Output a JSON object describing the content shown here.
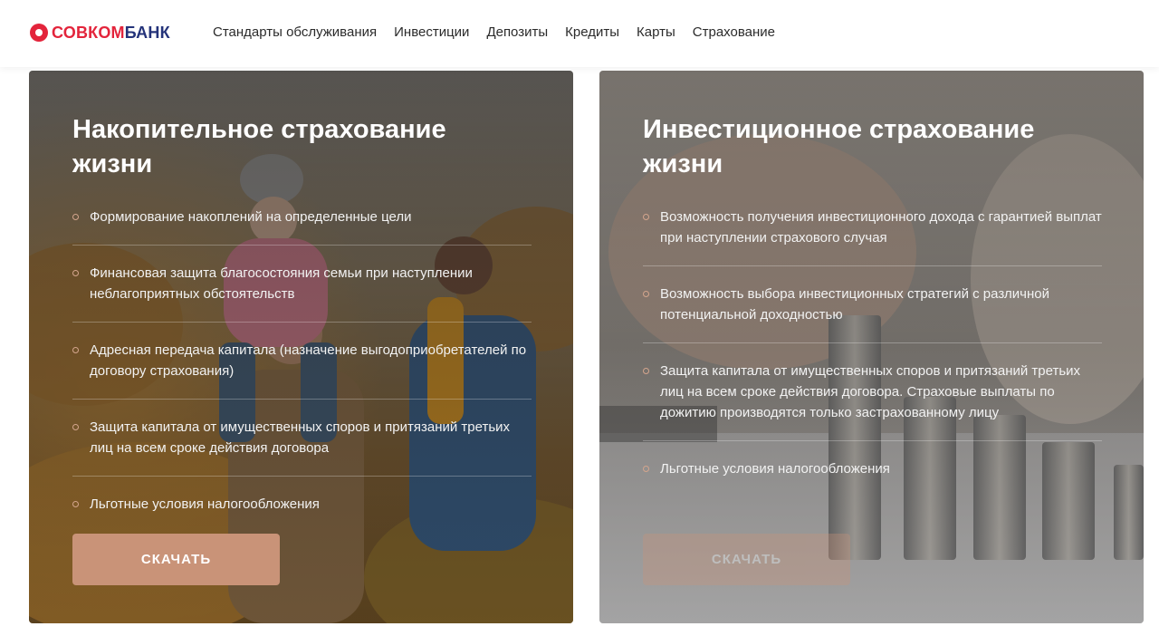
{
  "brand": {
    "logo_part_a": "СОВКОМ",
    "logo_part_b": "БАНК",
    "colors": {
      "red": "#e3243b",
      "navy": "#24337a",
      "accent": "#c99378"
    }
  },
  "nav": {
    "items": [
      {
        "label": "Стандарты обслуживания"
      },
      {
        "label": "Инвестиции"
      },
      {
        "label": "Депозиты"
      },
      {
        "label": "Кредиты"
      },
      {
        "label": "Карты"
      },
      {
        "label": "Страхование"
      }
    ]
  },
  "cards": [
    {
      "title": "Накопительное страхование жизни",
      "background": "photo-family-autumn",
      "features": [
        "Формирование накоплений на определенные цели",
        "Финансовая защита благосостояния семьи при наступлении неблагоприятных обстоятельств",
        "Адресная передача капитала (назначение выгодоприобретателей по договору страхования)",
        "Защита капитала от имущественных споров и притязаний третьих лиц на всем сроке действия договора",
        "Льготные условия налогообложения"
      ],
      "button_label": "СКАЧАТЬ"
    },
    {
      "title": "Инвестиционное страхование жизни",
      "background": "photo-coin-stacks",
      "features": [
        "Возможность получения инвестиционного дохода с гарантией выплат при наступлении страхового случая",
        "Возможность выбора инвестиционных стратегий с различной потенциальной доходностью",
        "Защита капитала от имущественных споров и притязаний третьих лиц на всем сроке действия договора. Страховые выплаты по дожитию производятся только застрахованному лицу",
        "Льготные условия налогообложения"
      ],
      "button_label": "СКАЧАТЬ"
    }
  ]
}
